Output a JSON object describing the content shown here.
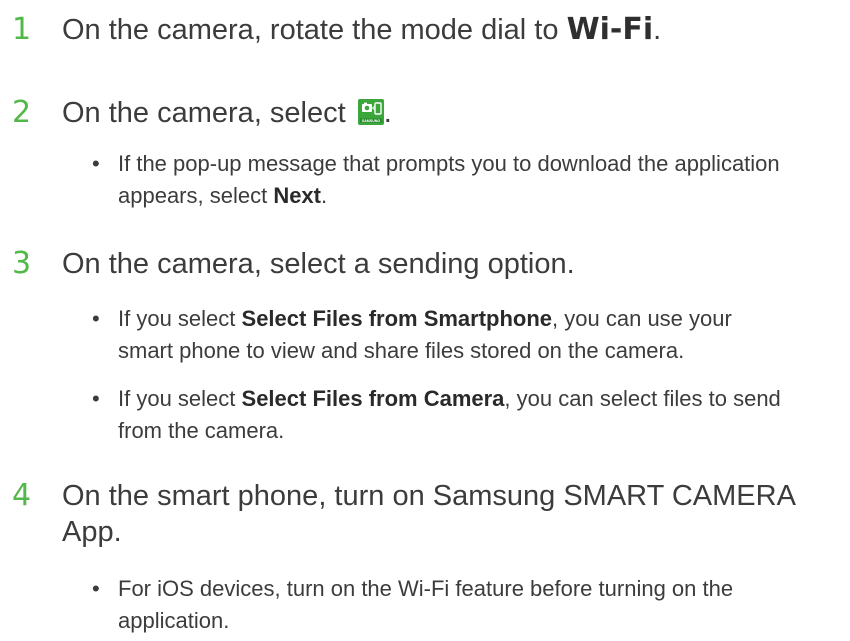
{
  "steps": [
    {
      "number": "1",
      "text_before": "On the camera, rotate the mode dial to ",
      "mode": "Wi-Fi",
      "text_after": "."
    },
    {
      "number": "2",
      "text_before": "On the camera, select ",
      "icon": "samsung-smart-camera-app-icon",
      "icon_label": "SAMSUNG",
      "text_after": ".",
      "bullets": [
        {
          "text_before": "If the pop-up message that prompts you to download the application appears, select ",
          "bold": "Next",
          "text_after": "."
        }
      ]
    },
    {
      "number": "3",
      "text": "On the camera, select a sending option.",
      "bullets": [
        {
          "text_before": "If you select ",
          "bold": "Select Files from Smartphone",
          "text_after": ", you can use your smart phone to view and share files stored on the camera."
        },
        {
          "text_before": "If you select ",
          "bold": "Select Files from Camera",
          "text_after": ", you can select files to send from the camera."
        }
      ]
    },
    {
      "number": "4",
      "text": "On the smart phone, turn on Samsung SMART CAMERA App.",
      "bullets": [
        {
          "text": "For iOS devices, turn on the Wi-Fi feature before turning on the application."
        }
      ]
    }
  ],
  "bullet_glyph": "•",
  "colors": {
    "step_number": "#52b848",
    "body_text": "#3c3c3c",
    "icon_bg": "#3aa63c"
  }
}
